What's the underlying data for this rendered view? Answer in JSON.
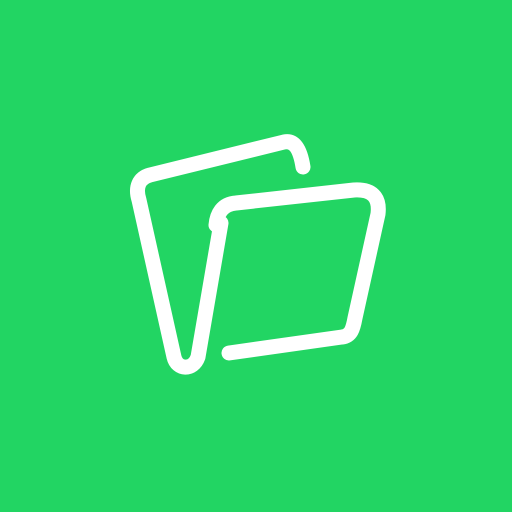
{
  "app_icon": {
    "icon": "folder-icon",
    "background_color": "#22d563",
    "glyph_color": "#ffffff"
  }
}
